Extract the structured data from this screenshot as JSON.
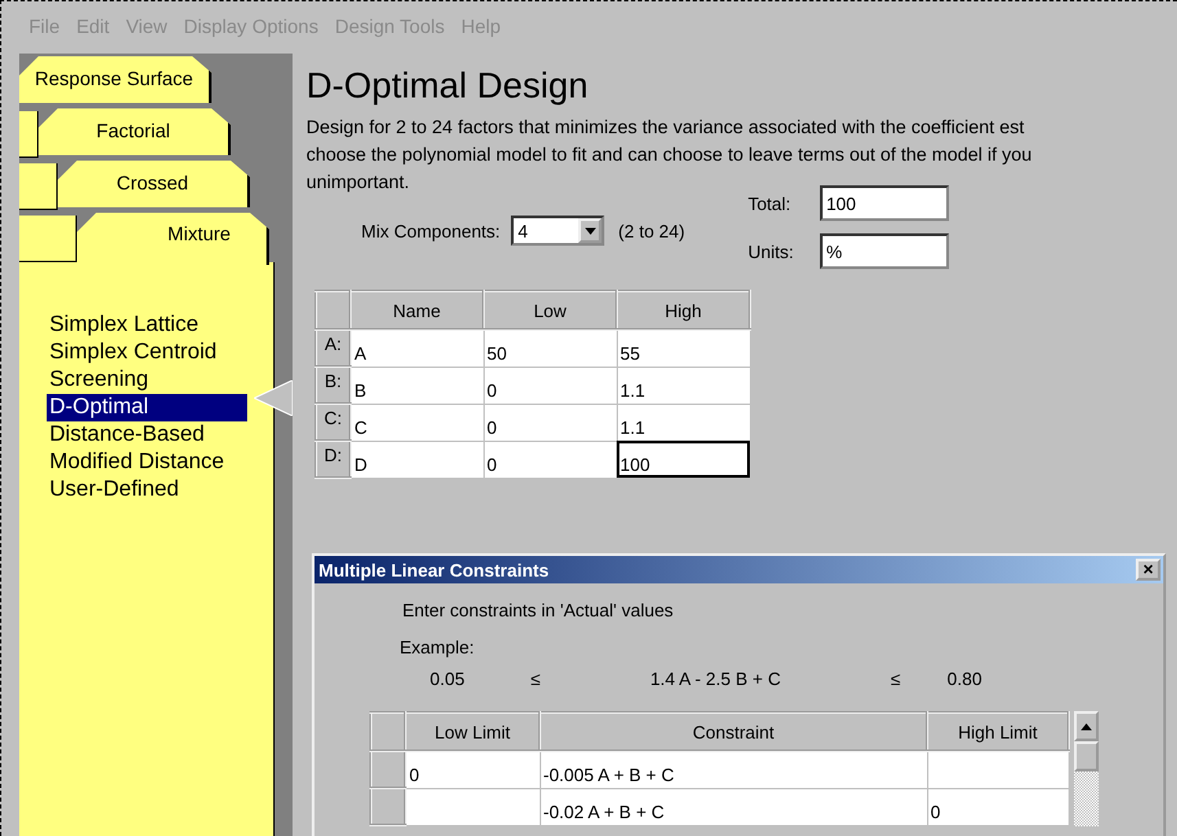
{
  "menu": [
    {
      "label": "File",
      "disabled": true
    },
    {
      "label": "Edit",
      "disabled": true
    },
    {
      "label": "View",
      "disabled": true
    },
    {
      "label": "Display Options",
      "disabled": true
    },
    {
      "label": "Design Tools",
      "disabled": true
    },
    {
      "label": "Help",
      "disabled": true
    }
  ],
  "tabs": [
    {
      "label": "Response Surface",
      "selected": false
    },
    {
      "label": "Factorial",
      "selected": false
    },
    {
      "label": "Crossed",
      "selected": false
    },
    {
      "label": "Mixture",
      "selected": true
    }
  ],
  "design_list": [
    {
      "label": "Simplex Lattice",
      "selected": false
    },
    {
      "label": "Simplex Centroid",
      "selected": false
    },
    {
      "label": "Screening",
      "selected": false
    },
    {
      "label": "D-Optimal",
      "selected": true
    },
    {
      "label": "Distance-Based",
      "selected": false
    },
    {
      "label": "Modified Distance",
      "selected": false
    },
    {
      "label": "User-Defined",
      "selected": false
    }
  ],
  "title": "D-Optimal Design",
  "description_lines": [
    "Design for 2 to 24 factors that minimizes the variance associated with the coefficient est",
    "choose the polynomial model to fit and can choose to leave terms out of the model if you",
    "unimportant."
  ],
  "mix_components": {
    "label": "Mix Components:",
    "value": "4",
    "range": "(2 to 24)"
  },
  "total": {
    "label": "Total:",
    "value": "100"
  },
  "units": {
    "label": "Units:",
    "value": "%"
  },
  "components_table": {
    "columns": [
      "Name",
      "Low",
      "High"
    ],
    "rows": [
      {
        "header": "A:",
        "cells": [
          "A",
          "50",
          "55"
        ],
        "focused": false
      },
      {
        "header": "B:",
        "cells": [
          "B",
          "0",
          "1.1"
        ],
        "focused": false
      },
      {
        "header": "C:",
        "cells": [
          "C",
          "0",
          "1.1"
        ],
        "focused": false
      },
      {
        "header": "D:",
        "cells": [
          "D",
          "0",
          "100"
        ],
        "focused": true
      }
    ]
  },
  "dialog": {
    "title": "Multiple Linear Constraints",
    "close": "×",
    "instruction": "Enter constraints in 'Actual' values",
    "example_label": "Example:",
    "example": {
      "low": "0.05",
      "le1": "≤",
      "constraint": "1.4 A - 2.5 B + C",
      "le2": "≤",
      "high": "0.80"
    },
    "columns": [
      "Low Limit",
      "Constraint",
      "High Limit"
    ],
    "rows": [
      [
        "0",
        "-0.005 A  + B  + C",
        ""
      ],
      [
        "",
        "-0.02 A  + B  + C",
        "0"
      ]
    ]
  }
}
